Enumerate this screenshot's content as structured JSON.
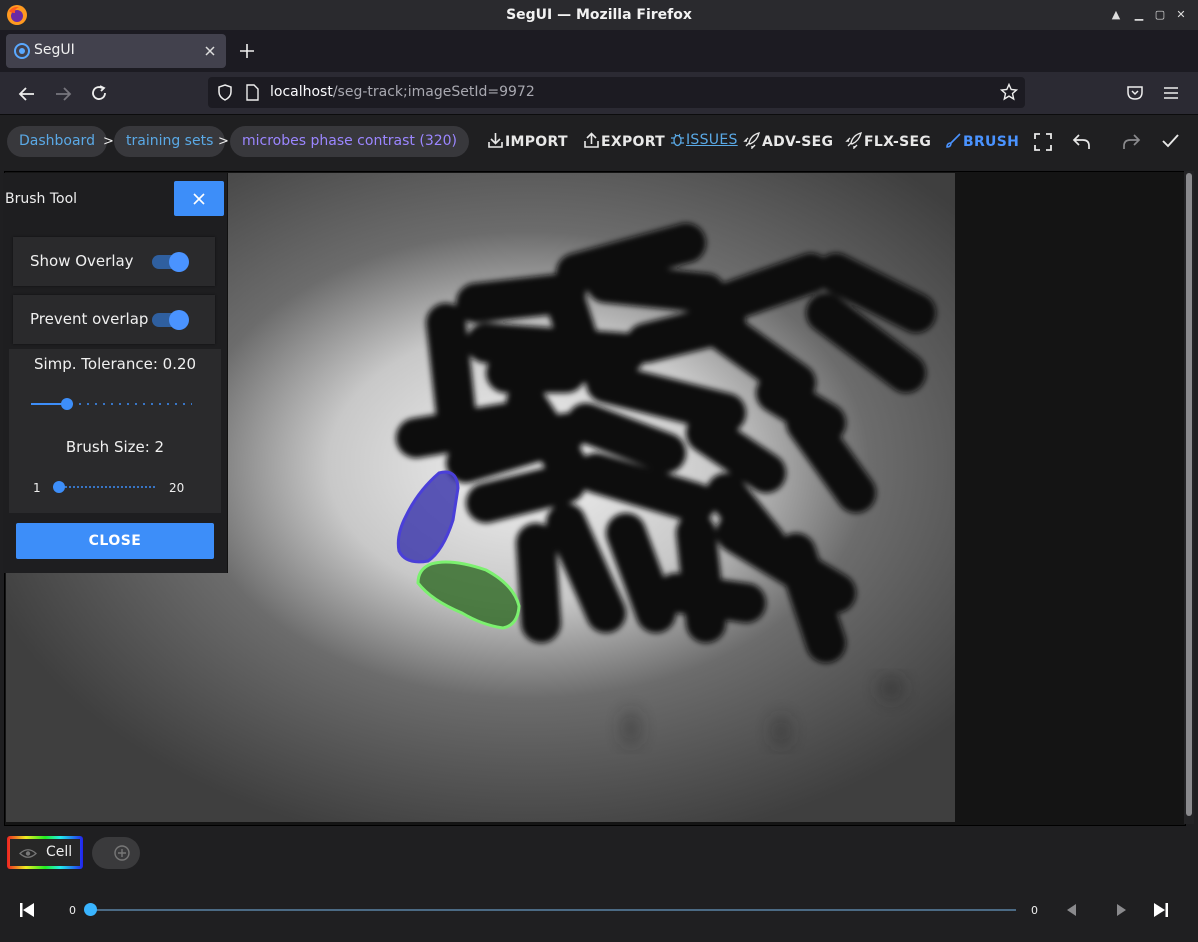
{
  "window": {
    "title": "SegUI — Mozilla Firefox"
  },
  "tab": {
    "label": "SegUI"
  },
  "address": {
    "host": "localhost",
    "path": "/seg-track;imageSetId=9972"
  },
  "breadcrumb": [
    {
      "label": "Dashboard"
    },
    {
      "label": "training sets"
    },
    {
      "label": "microbes phase contrast (320)"
    }
  ],
  "breadcrumb_sep": ">",
  "toolbar": {
    "import": "IMPORT",
    "export": "EXPORT",
    "issues": "ISSUES",
    "adv_seg": "ADV-SEG",
    "flx_seg": "FLX-SEG",
    "brush": "BRUSH"
  },
  "brush_panel": {
    "title": "Brush Tool",
    "show_overlay": {
      "label": "Show Overlay",
      "on": true
    },
    "prevent_overlap": {
      "label": "Prevent overlap",
      "on": true
    },
    "tolerance": {
      "label": "Simp. Tolerance: 0.20",
      "value": 0.2
    },
    "brush_size": {
      "label": "Brush Size: 2",
      "value": 2,
      "min": "1",
      "max": "20"
    },
    "close": "CLOSE"
  },
  "annotations": [
    {
      "name": "blue-cell-annotation",
      "color": "#4a3fd8"
    },
    {
      "name": "green-cell-annotation",
      "color": "#7cf06f"
    }
  ],
  "label_chips": [
    {
      "label": "Cell"
    }
  ],
  "timeline": {
    "start": "0",
    "end": "0",
    "position": 0
  },
  "colors": {
    "accent": "#3d8ef9",
    "breadcrumb_text": "#5aa9e6",
    "breadcrumb_active": "#9b86ff"
  }
}
